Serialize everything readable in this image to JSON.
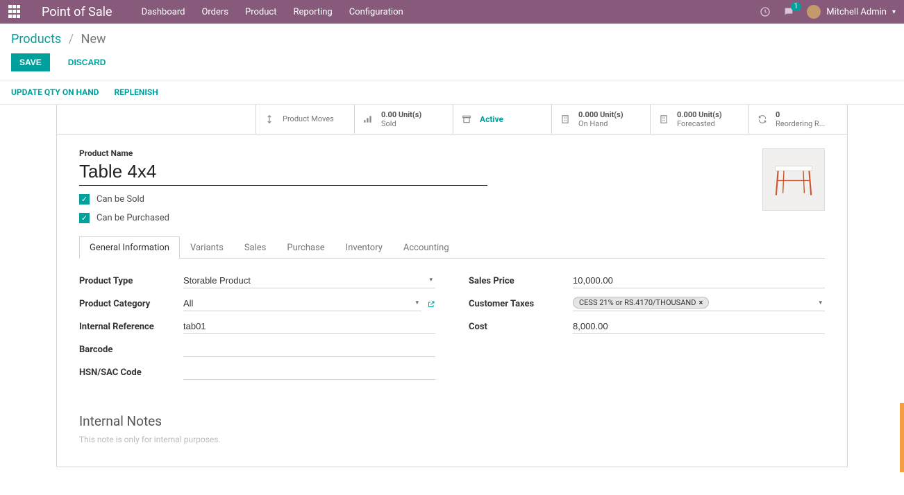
{
  "nav": {
    "brand": "Point of Sale",
    "items": [
      "Dashboard",
      "Orders",
      "Product",
      "Reporting",
      "Configuration"
    ],
    "chat_badge": "1",
    "user": "Mitchell Admin"
  },
  "breadcrumb": {
    "root": "Products",
    "current": "New"
  },
  "cp": {
    "save": "Save",
    "discard": "Discard"
  },
  "actions": {
    "update_qty": "Update Qty On Hand",
    "replenish": "Replenish"
  },
  "stats": {
    "moves": "Product Moves",
    "sold": {
      "value": "0.00 Unit(s)",
      "label": "Sold"
    },
    "active": "Active",
    "onhand": {
      "value": "0.000 Unit(s)",
      "label": "On Hand"
    },
    "forecast": {
      "value": "0.000 Unit(s)",
      "label": "Forecasted"
    },
    "reorder": {
      "value": "0",
      "label": "Reordering R..."
    }
  },
  "form": {
    "name_label": "Product Name",
    "name": "Table 4x4",
    "can_sold": "Can be Sold",
    "can_purchased": "Can be Purchased"
  },
  "tabs": [
    "General Information",
    "Variants",
    "Sales",
    "Purchase",
    "Inventory",
    "Accounting"
  ],
  "fields": {
    "left": {
      "type_label": "Product Type",
      "type_val": "Storable Product",
      "cat_label": "Product Category",
      "cat_val": "All",
      "ref_label": "Internal Reference",
      "ref_val": "tab01",
      "barcode_label": "Barcode",
      "barcode_val": "",
      "hsn_label": "HSN/SAC Code",
      "hsn_val": ""
    },
    "right": {
      "price_label": "Sales Price",
      "price_val": "10,000.00",
      "taxes_label": "Customer Taxes",
      "tax_tag": "CESS 21% or RS.4170/THOUSAND",
      "cost_label": "Cost",
      "cost_val": "8,000.00"
    }
  },
  "notes": {
    "heading": "Internal Notes",
    "placeholder": "This note is only for internal purposes."
  }
}
